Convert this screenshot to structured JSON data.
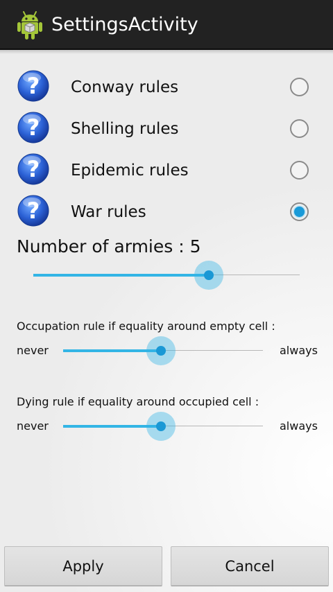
{
  "app": {
    "title": "SettingsActivity",
    "icon": "android-robot-icon"
  },
  "rules": [
    {
      "label": "Conway rules",
      "icon": "help-icon",
      "selected": false
    },
    {
      "label": "Shelling rules",
      "icon": "help-icon",
      "selected": false
    },
    {
      "label": "Epidemic rules",
      "icon": "help-icon",
      "selected": false
    },
    {
      "label": "War rules",
      "icon": "help-icon",
      "selected": true
    }
  ],
  "armies": {
    "label": "Number of armies : ",
    "value": "5",
    "slider_fraction": 0.66
  },
  "occupation": {
    "label": "Occupation rule if equality around empty cell :",
    "min_label": "never",
    "max_label": "always",
    "slider_fraction": 0.49
  },
  "dying": {
    "label": "Dying rule if equality around occupied cell :",
    "min_label": "never",
    "max_label": "always",
    "slider_fraction": 0.49
  },
  "buttons": {
    "apply": "Apply",
    "cancel": "Cancel"
  },
  "colors": {
    "accent": "#33b5e5",
    "action_bar": "#222222"
  }
}
